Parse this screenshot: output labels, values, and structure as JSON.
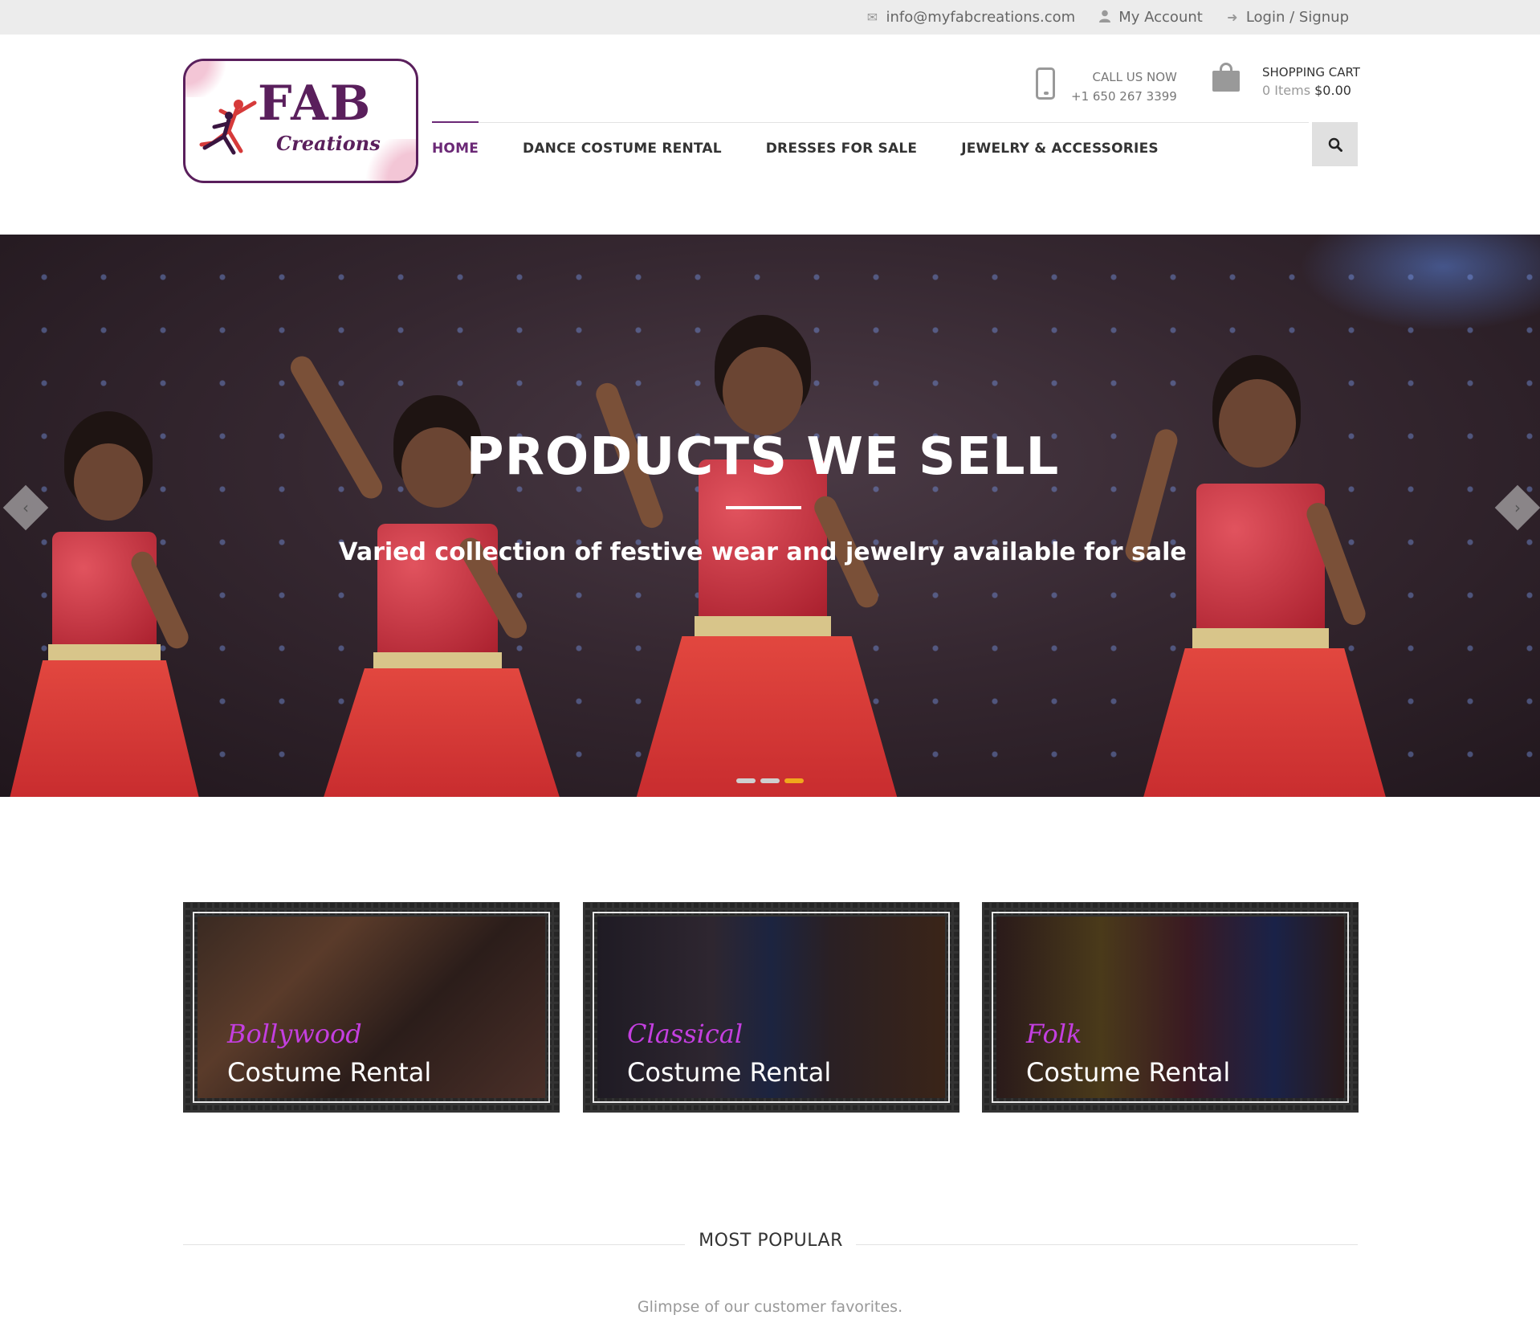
{
  "topbar": {
    "email": "info@myfabcreations.com",
    "account": "My Account",
    "login": "Login / Signup"
  },
  "logo": {
    "title": "FAB",
    "subtitle": "Creations"
  },
  "header": {
    "call_label": "CALL US NOW",
    "phone": "+1 650 267 3399",
    "cart_label": "SHOPPING CART",
    "cart_items": "0 Items",
    "cart_total": "$0.00"
  },
  "nav": {
    "items": [
      {
        "label": "HOME",
        "active": true
      },
      {
        "label": "DANCE COSTUME RENTAL",
        "active": false
      },
      {
        "label": "DRESSES FOR SALE",
        "active": false
      },
      {
        "label": "JEWELRY & ACCESSORIES",
        "active": false
      }
    ]
  },
  "hero": {
    "title": "PRODUCTS WE SELL",
    "subtitle": "Varied collection of festive wear and jewelry available for sale",
    "slide_count": 3,
    "active_slide": 3
  },
  "categories": [
    {
      "script": "Bollywood",
      "name": "Costume Rental"
    },
    {
      "script": "Classical",
      "name": "Costume Rental"
    },
    {
      "script": "Folk",
      "name": "Costume Rental"
    }
  ],
  "most_popular": {
    "title": "MOST POPULAR",
    "subtitle": "Glimpse of our customer favorites."
  },
  "colors": {
    "brand_purple": "#6b2876",
    "script_magenta": "#c43fe0",
    "bullet_active": "#f0a81c",
    "topbar_bg": "#ececec"
  },
  "icons": {
    "email": "envelope-icon",
    "account": "user-icon",
    "login": "sign-in-icon",
    "phone": "mobile-phone-icon",
    "cart": "shopping-bag-icon",
    "search": "search-icon"
  }
}
